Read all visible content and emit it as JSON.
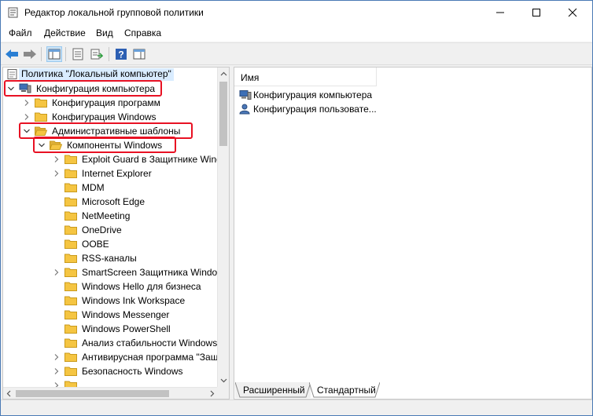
{
  "window": {
    "title": "Редактор локальной групповой политики"
  },
  "menu": {
    "items": [
      {
        "label": "Файл"
      },
      {
        "label": "Действие"
      },
      {
        "label": "Вид"
      },
      {
        "label": "Справка"
      }
    ]
  },
  "tree": {
    "root": "Политика \"Локальный компьютер\"",
    "items": [
      {
        "label": "Конфигурация компьютера",
        "icon": "computer-icon",
        "expanded": true
      },
      {
        "label": "Конфигурация программ",
        "icon": "folder-icon"
      },
      {
        "label": "Конфигурация Windows",
        "icon": "folder-icon"
      },
      {
        "label": "Административные шаблоны",
        "icon": "folder-open-icon",
        "expanded": true
      },
      {
        "label": "Компоненты Windows",
        "icon": "folder-open-icon",
        "expanded": true
      },
      {
        "label": "Exploit Guard в Защитнике Windows",
        "icon": "folder-icon"
      },
      {
        "label": "Internet Explorer",
        "icon": "folder-icon"
      },
      {
        "label": "MDM",
        "icon": "folder-icon"
      },
      {
        "label": "Microsoft Edge",
        "icon": "folder-icon"
      },
      {
        "label": "NetMeeting",
        "icon": "folder-icon"
      },
      {
        "label": "OneDrive",
        "icon": "folder-icon"
      },
      {
        "label": "OOBE",
        "icon": "folder-icon"
      },
      {
        "label": "RSS-каналы",
        "icon": "folder-icon"
      },
      {
        "label": "SmartScreen Защитника Windows",
        "icon": "folder-icon"
      },
      {
        "label": "Windows Hello для бизнеса",
        "icon": "folder-icon"
      },
      {
        "label": "Windows Ink Workspace",
        "icon": "folder-icon"
      },
      {
        "label": "Windows Messenger",
        "icon": "folder-icon"
      },
      {
        "label": "Windows PowerShell",
        "icon": "folder-icon"
      },
      {
        "label": "Анализ стабильности Windows",
        "icon": "folder-icon"
      },
      {
        "label": "Антивирусная программа \"Защитник Windows\"",
        "icon": "folder-icon"
      },
      {
        "label": "Безопасность Windows",
        "icon": "folder-icon"
      }
    ]
  },
  "list": {
    "column_header": "Имя",
    "items": [
      {
        "label": "Конфигурация компьютера",
        "icon": "computer-icon"
      },
      {
        "label": "Конфигурация пользовате...",
        "icon": "user-icon"
      }
    ]
  },
  "tabs": [
    {
      "label": "Расширенный"
    },
    {
      "label": "Стандартный"
    }
  ],
  "colors": {
    "highlight": "#e81123",
    "selection": "#d9ecff",
    "folder": "#f5c542"
  }
}
